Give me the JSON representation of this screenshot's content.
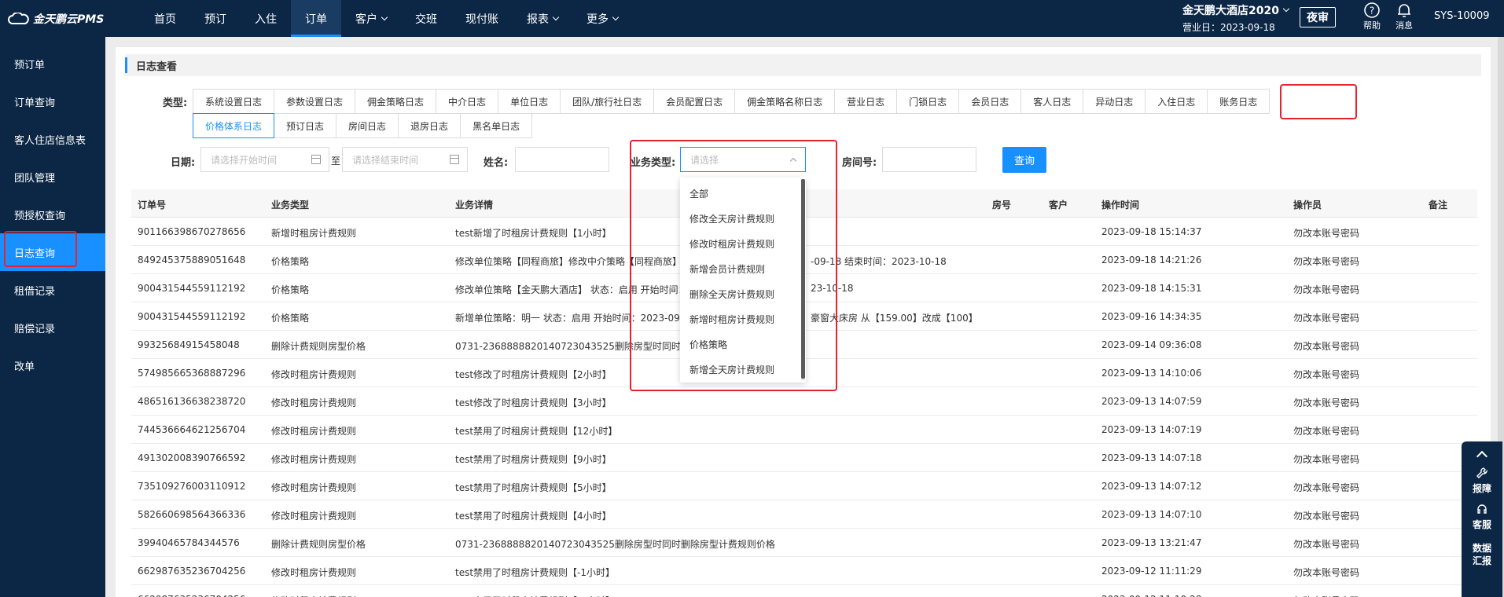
{
  "header": {
    "logo": "金天鹏云PMS",
    "nav": [
      {
        "label": "首页",
        "dropdown": false
      },
      {
        "label": "预订",
        "dropdown": false
      },
      {
        "label": "入住",
        "dropdown": false
      },
      {
        "label": "订单",
        "dropdown": false,
        "active": true
      },
      {
        "label": "客户",
        "dropdown": true
      },
      {
        "label": "交班",
        "dropdown": false
      },
      {
        "label": "现付账",
        "dropdown": false
      },
      {
        "label": "报表",
        "dropdown": true
      },
      {
        "label": "更多",
        "dropdown": true
      }
    ],
    "hotel_name": "金天鹏大酒店2020",
    "business_date": "营业日：2023-09-18",
    "night_audit": "夜审",
    "help": "帮助",
    "messages": "消息",
    "user": "SYS-10009"
  },
  "sidebar": {
    "items": [
      {
        "label": "预订单"
      },
      {
        "label": "订单查询"
      },
      {
        "label": "客人住店信息表"
      },
      {
        "label": "团队管理"
      },
      {
        "label": "预授权查询"
      },
      {
        "label": "日志查询",
        "active": true
      },
      {
        "label": "租借记录"
      },
      {
        "label": "赔偿记录"
      },
      {
        "label": "改单"
      }
    ]
  },
  "panel": {
    "title": "日志查看",
    "type_label": "类型:",
    "type_tabs": [
      {
        "label": "系统设置日志"
      },
      {
        "label": "参数设置日志"
      },
      {
        "label": "佣金策略日志"
      },
      {
        "label": "中介日志"
      },
      {
        "label": "单位日志"
      },
      {
        "label": "团队/旅行社日志"
      },
      {
        "label": "会员配置日志"
      },
      {
        "label": "佣金策略名称日志"
      },
      {
        "label": "营业日志"
      },
      {
        "label": "门锁日志"
      },
      {
        "label": "会员日志"
      },
      {
        "label": "客人日志"
      },
      {
        "label": "异动日志"
      },
      {
        "label": "入住日志"
      },
      {
        "label": "账务日志"
      },
      {
        "label": "价格体系日志",
        "active": true
      },
      {
        "label": "预订日志"
      },
      {
        "label": "房间日志"
      },
      {
        "label": "退房日志"
      },
      {
        "label": "黑名单日志"
      }
    ],
    "filters": {
      "date_label": "日期:",
      "start_placeholder": "请选择开始时间",
      "to": "至",
      "end_placeholder": "请选择结束时间",
      "name_label": "姓名:",
      "business_type_label": "业务类型:",
      "business_type_placeholder": "请选择",
      "room_label": "房间号:",
      "query_button": "查询"
    },
    "business_type_options": [
      "全部",
      "修改全天房计费规则",
      "修改时租房计费规则",
      "新增会员计费规则",
      "删除全天房计费规则",
      "新增时租房计费规则",
      "价格策略",
      "新增全天房计费规则"
    ]
  },
  "table": {
    "columns": [
      "订单号",
      "业务类型",
      "业务详情",
      "房号",
      "客户",
      "操作时间",
      "操作员",
      "备注"
    ],
    "rows": [
      {
        "order": "901166398670278656",
        "type": "新增时租房计费规则",
        "detail": "test新增了时租房计费规则【1小时】",
        "detail2": "",
        "time": "2023-09-18 15:14:37",
        "operator": "勿改本账号密码"
      },
      {
        "order": "849245375889051648",
        "type": "价格策略",
        "detail": "修改单位策略【同程商旅】修改中介策略【同程商旅】",
        "detail2": "-09-18 结束时间：2023-10-18",
        "time": "2023-09-18 14:21:26",
        "operator": "勿改本账号密码"
      },
      {
        "order": "900431544559112192",
        "type": "价格策略",
        "detail": "修改单位策略【金天鹏大酒店】 状态：启用 开始时间：",
        "detail2": "23-10-18",
        "time": "2023-09-18 14:15:31",
        "operator": "勿改本账号密码"
      },
      {
        "order": "900431544559112192",
        "type": "价格策略",
        "detail": "新增单位策略：明一 状态：启用 开始时间：2023-09",
        "detail2": "豪窗大床房 从【159.00】改成【100】",
        "time": "2023-09-16 14:34:35",
        "operator": "勿改本账号密码"
      },
      {
        "order": "99325684915458048",
        "type": "删除计费规则房型价格",
        "detail": "0731-2368888820140723043525删除房型时同时删除",
        "detail2": "",
        "time": "2023-09-14 09:36:08",
        "operator": "勿改本账号密码"
      },
      {
        "order": "574985665368887296",
        "type": "修改时租房计费规则",
        "detail": "test修改了时租房计费规则【2小时】",
        "detail2": "",
        "time": "2023-09-13 14:10:06",
        "operator": "勿改本账号密码"
      },
      {
        "order": "486516136638238720",
        "type": "修改时租房计费规则",
        "detail": "test修改了时租房计费规则【3小时】",
        "detail2": "",
        "time": "2023-09-13 14:07:59",
        "operator": "勿改本账号密码"
      },
      {
        "order": "744536664621256704",
        "type": "修改时租房计费规则",
        "detail": "test禁用了时租房计费规则【12小时】",
        "detail2": "",
        "time": "2023-09-13 14:07:19",
        "operator": "勿改本账号密码"
      },
      {
        "order": "491302008390766592",
        "type": "修改时租房计费规则",
        "detail": "test禁用了时租房计费规则【9小时】",
        "detail2": "",
        "time": "2023-09-13 14:07:18",
        "operator": "勿改本账号密码"
      },
      {
        "order": "735109276003110912",
        "type": "修改时租房计费规则",
        "detail": "test禁用了时租房计费规则【5小时】",
        "detail2": "",
        "time": "2023-09-13 14:07:12",
        "operator": "勿改本账号密码"
      },
      {
        "order": "582660698564366336",
        "type": "修改时租房计费规则",
        "detail": "test禁用了时租房计费规则【4小时】",
        "detail2": "",
        "time": "2023-09-13 14:07:10",
        "operator": "勿改本账号密码"
      },
      {
        "order": "39940465784344576",
        "type": "删除计费规则房型价格",
        "detail": "0731-2368888820140723043525删除房型时同时删除房型计费规则价格",
        "detail2": "",
        "time": "2023-09-13 13:21:47",
        "operator": "勿改本账号密码"
      },
      {
        "order": "662987635236704256",
        "type": "修改时租房计费规则",
        "detail": "test禁用了时租房计费规则【-1小时】",
        "detail2": "",
        "time": "2023-09-12 11:11:29",
        "operator": "勿改本账号密码"
      },
      {
        "order": "662987635236704256",
        "type": "修改时租房计费规则",
        "detail": "test启用了时租房计费规则【-1小时】",
        "detail2": "",
        "time": "2023-09-12 11:10:28",
        "operator": "勿改本账号密码"
      }
    ]
  },
  "float_widget": {
    "report": "报障",
    "service": "客服",
    "data_report_1": "数据",
    "data_report_2": "汇报"
  },
  "colors": {
    "nav_bg": "#0c2746",
    "accent": "#1890ff",
    "highlight": "#e5222d"
  }
}
